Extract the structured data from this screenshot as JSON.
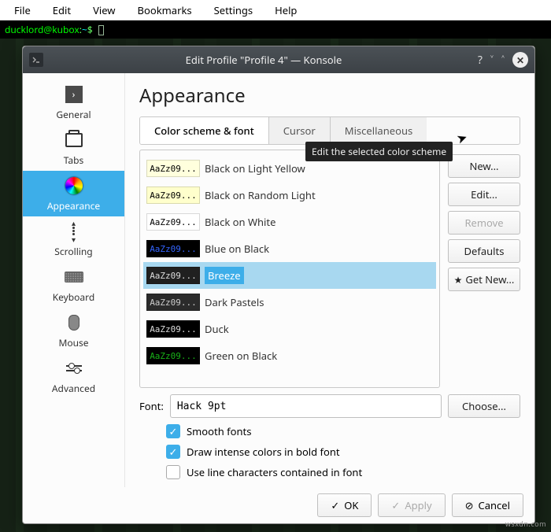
{
  "menubar": [
    "File",
    "Edit",
    "View",
    "Bookmarks",
    "Settings",
    "Help"
  ],
  "terminal": {
    "prompt": "ducklord@kubox",
    "path": "~",
    "sep": ":",
    "dollar": "$"
  },
  "dialog": {
    "title": "Edit Profile \"Profile 4\" — Konsole",
    "heading": "Appearance"
  },
  "sidebar": {
    "items": [
      {
        "label": "General"
      },
      {
        "label": "Tabs"
      },
      {
        "label": "Appearance"
      },
      {
        "label": "Scrolling"
      },
      {
        "label": "Keyboard"
      },
      {
        "label": "Mouse"
      },
      {
        "label": "Advanced"
      }
    ]
  },
  "tabs": [
    "Color scheme & font",
    "Cursor",
    "Miscellaneous"
  ],
  "schemes": [
    {
      "name": "Black on Light Yellow",
      "bg": "#ffffdd",
      "fg": "#000000"
    },
    {
      "name": "Black on Random Light",
      "bg": "#ffffcc",
      "fg": "#000000"
    },
    {
      "name": "Black on White",
      "bg": "#ffffff",
      "fg": "#000000"
    },
    {
      "name": "Blue on Black",
      "bg": "#000000",
      "fg": "#3465ff"
    },
    {
      "name": "Breeze",
      "bg": "#202020",
      "fg": "#dddddd",
      "selected": true
    },
    {
      "name": "Dark Pastels",
      "bg": "#2b2b2b",
      "fg": "#cccccc"
    },
    {
      "name": "Duck",
      "bg": "#000000",
      "fg": "#dddddd"
    },
    {
      "name": "Green on Black",
      "bg": "#000000",
      "fg": "#18b218"
    }
  ],
  "scheme_sample": "AaZz09...",
  "buttons": {
    "new": "New...",
    "edit": "Edit...",
    "remove": "Remove",
    "defaults": "Defaults",
    "getnew": "Get New..."
  },
  "tooltip": "Edit the selected color scheme",
  "font": {
    "label": "Font:",
    "value": "Hack  9pt",
    "choose": "Choose..."
  },
  "checks": {
    "smooth": {
      "label": "Smooth fonts",
      "checked": true
    },
    "bold": {
      "label": "Draw intense colors in bold font",
      "checked": true
    },
    "linechars": {
      "label": "Use line characters contained in font",
      "checked": false
    }
  },
  "dlg": {
    "ok": "OK",
    "apply": "Apply",
    "cancel": "Cancel"
  },
  "watermark": "wsxdn.com"
}
